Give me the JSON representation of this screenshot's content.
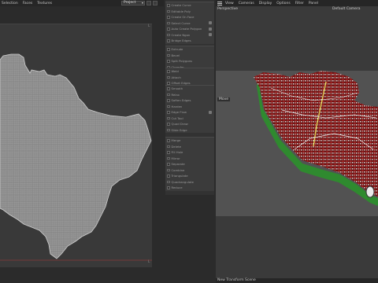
{
  "left_menu": [
    "Selection",
    "Faces",
    "Textures"
  ],
  "project_select": "Project",
  "center_groups": [
    {
      "rows": [
        "Create Curve",
        "Editable Poly",
        "Create On Face",
        "Select Curve",
        "",
        "Auto Create Polygon",
        "Create Ngon",
        "Bridge Edges",
        "Connect"
      ],
      "toggles": [
        4,
        5
      ]
    },
    {
      "rows": [
        "Extrude",
        "Bevel",
        "Split Polygons",
        "Chamfer",
        "Collapse"
      ]
    },
    {
      "rows": [
        "Weld",
        "Attach",
        "Offset Edges"
      ]
    },
    {
      "rows": [
        "Smooth",
        "Relax",
        "Soften Edges",
        "Harden",
        "Edge Flow",
        "Cut Tool",
        "Quad Draw",
        "Slide Edge"
      ],
      "toggles": [
        4
      ]
    },
    {
      "rows": [
        "Merge",
        "Delete",
        "Fill Hole",
        "Mirror",
        "Separate",
        "Combine",
        "Triangulate",
        "Quadrangulate",
        "Reduce"
      ]
    }
  ],
  "right_menu": [
    "View",
    "Cameras",
    "Display",
    "Options",
    "Filter",
    "Panel"
  ],
  "viewport_label": "Perspective",
  "camera_label": "Default Camera",
  "move_label": "Move",
  "status_text": "New Transform Scene",
  "edge_marks": [
    "L",
    "L",
    "L"
  ],
  "colors": {
    "accent_red": "#b01818",
    "roads": "#e6e6e6",
    "highlight": "#e3d35a",
    "grass": "#3fa83f"
  }
}
